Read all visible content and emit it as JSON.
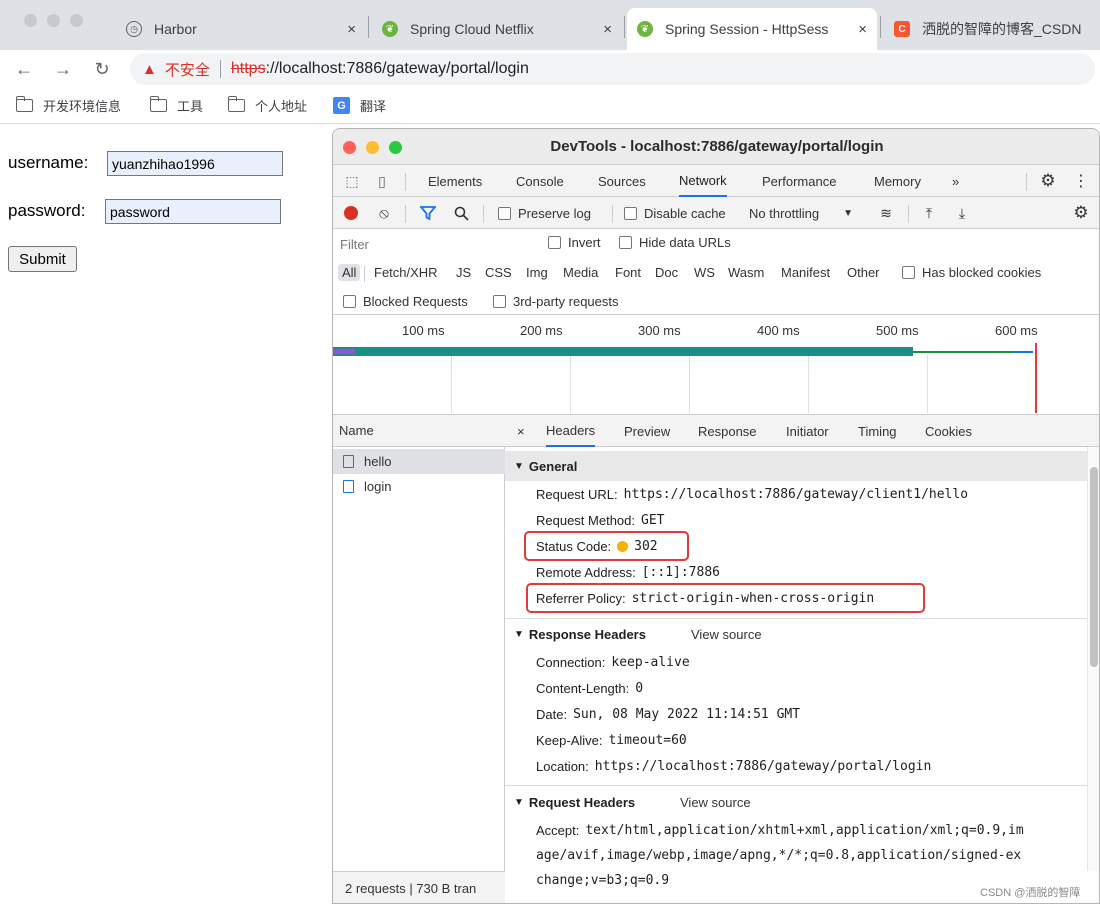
{
  "browser": {
    "tabs": [
      {
        "label": "Harbor",
        "icon": "clock-icon",
        "color": "#5f6368"
      },
      {
        "label": "Spring Cloud Netflix",
        "icon": "spring-leaf-icon",
        "color": "#6db33f"
      },
      {
        "label": "Spring Session - HttpSess",
        "icon": "spring-leaf-icon",
        "color": "#6db33f"
      },
      {
        "label": "洒脱的智障的博客_CSDN",
        "icon": "csdn-icon",
        "color": "#fc5531"
      }
    ],
    "tab_close": "×",
    "security_warning": "不安全",
    "url_scheme": "https",
    "url_rest": "://localhost:7886/gateway/portal/login",
    "bookmarks": [
      "开发环境信息",
      "工具",
      "个人地址",
      "翻译"
    ]
  },
  "page": {
    "username_label": "username:",
    "username_value": "yuanzhihao1996",
    "password_label": "password:",
    "password_value": "password",
    "submit_label": "Submit"
  },
  "devtools": {
    "title": "DevTools - localhost:7886/gateway/portal/login",
    "main_tabs": [
      "Elements",
      "Console",
      "Sources",
      "Network",
      "Performance",
      "Memory"
    ],
    "more_tabs": "»",
    "active_tab": "Network",
    "net_toolbar": {
      "preserve_log": "Preserve log",
      "disable_cache": "Disable cache",
      "throttling": "No throttling"
    },
    "filter": {
      "placeholder": "Filter",
      "invert": "Invert",
      "hide_data_urls": "Hide data URLs",
      "types": [
        "All",
        "Fetch/XHR",
        "JS",
        "CSS",
        "Img",
        "Media",
        "Font",
        "Doc",
        "WS",
        "Wasm",
        "Manifest",
        "Other"
      ],
      "has_blocked_cookies": "Has blocked cookies",
      "blocked_requests": "Blocked Requests",
      "third_party": "3rd-party requests"
    },
    "timeline": {
      "ticks": [
        "100 ms",
        "200 ms",
        "300 ms",
        "400 ms",
        "500 ms",
        "600 ms"
      ]
    },
    "requests": {
      "header": "Name",
      "items": [
        "hello",
        "login"
      ],
      "footer": "2 requests | 730 B tran"
    },
    "detail_tabs": [
      "×",
      "Headers",
      "Preview",
      "Response",
      "Initiator",
      "Timing",
      "Cookies"
    ],
    "general": {
      "title": "General",
      "request_url_key": "Request URL:",
      "request_url": "https://localhost:7886/gateway/client1/hello",
      "method_key": "Request Method:",
      "method": "GET",
      "status_key": "Status Code:",
      "status": "302",
      "remote_key": "Remote Address:",
      "remote": "[::1]:7886",
      "referrer_key": "Referrer Policy:",
      "referrer": "strict-origin-when-cross-origin"
    },
    "response_headers": {
      "title": "Response Headers",
      "view_source": "View source",
      "connection_key": "Connection:",
      "connection": "keep-alive",
      "length_key": "Content-Length:",
      "length": "0",
      "date_key": "Date:",
      "date": "Sun, 08 May 2022 11:14:51 GMT",
      "keepalive_key": "Keep-Alive:",
      "keepalive": "timeout=60",
      "location_key": "Location:",
      "location": "https://localhost:7886/gateway/portal/login"
    },
    "request_headers": {
      "title": "Request Headers",
      "view_source": "View source",
      "accept_key": "Accept:",
      "accept_1": "text/html,application/xhtml+xml,application/xml;q=0.9,im",
      "accept_2": "age/avif,image/webp,image/apng,*/*;q=0.8,application/signed-ex",
      "accept_3": "change;v=b3;q=0.9"
    }
  },
  "watermark": "CSDN @洒脱的智障",
  "colors": {
    "accent": "#1a73e8",
    "highlight_box": "#e53935",
    "status_dot": "#f4b400"
  }
}
